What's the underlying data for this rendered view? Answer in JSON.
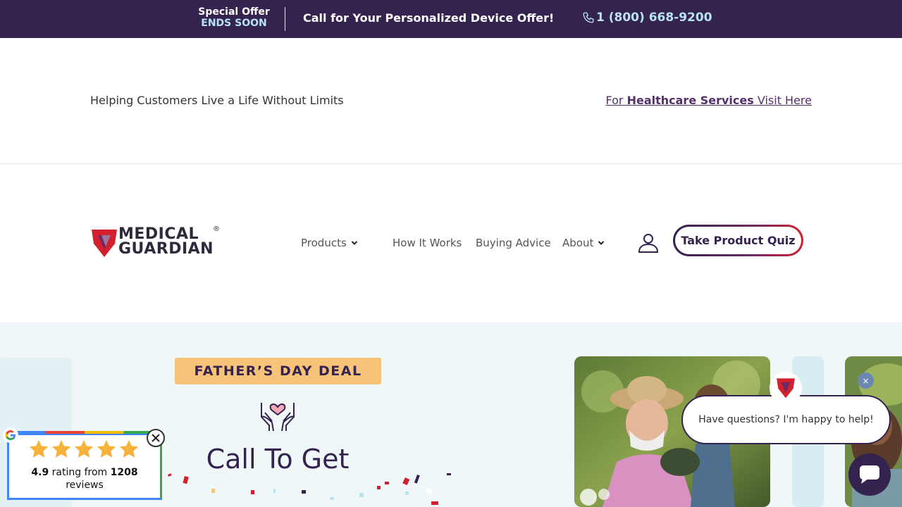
{
  "promo_bar": {
    "special_line1": "Special Offer",
    "special_line2": "ENDS SOON",
    "message": "Call for Your Personalized Device Offer!",
    "phone": "1 (800) 668-9200"
  },
  "header_top": {
    "tagline": "Helping Customers Live a Life Without Limits",
    "healthcare_prefix": "For",
    "healthcare_bold": "Healthcare Services",
    "healthcare_suffix": "Visit Here"
  },
  "logo": {
    "line1": "MEDICAL",
    "line2": "GUARDIAN",
    "reg": "®"
  },
  "nav": {
    "items": [
      {
        "label": "Products",
        "has_dropdown": true
      },
      {
        "label": "How It Works",
        "has_dropdown": false
      },
      {
        "label": "Buying Advice",
        "has_dropdown": false
      },
      {
        "label": "About",
        "has_dropdown": true
      }
    ],
    "quiz_button": "Take Product Quiz",
    "account_icon": "user-icon"
  },
  "hero": {
    "badge": "FATHER’S DAY DEAL",
    "icon": "hands-heart-icon",
    "title": "Call To Get"
  },
  "chat": {
    "message": "Have questions? I'm happy to help!",
    "close_label": "×"
  },
  "review": {
    "rating": "4.9",
    "rating_text": "rating from",
    "count": "1208",
    "reviews_label": "reviews",
    "stars": 5
  },
  "colors": {
    "brand_purple": "#34224f",
    "accent_blue": "#b9e3f0",
    "badge_orange": "#f7c379",
    "brand_red": "#d3202f"
  }
}
